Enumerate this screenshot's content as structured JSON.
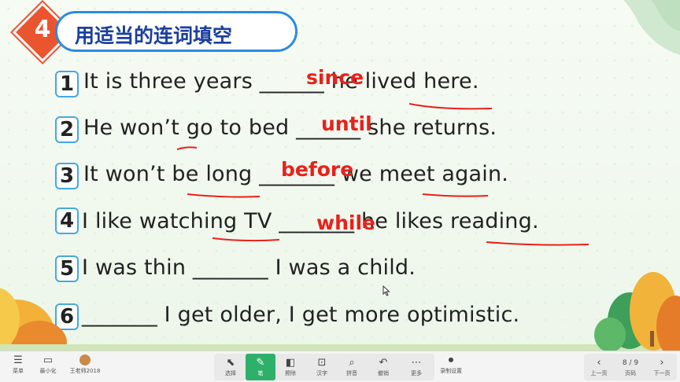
{
  "slide": {
    "number": "4",
    "title": "用适当的连词填空",
    "sentences": [
      {
        "num": "1",
        "text": "It is three years ______ he lived here.",
        "answer": "since"
      },
      {
        "num": "2",
        "text": "He won’t go to bed ______ she returns.",
        "answer": "until"
      },
      {
        "num": "3",
        "text": "It won’t be long _______ we meet again.",
        "answer": "before"
      },
      {
        "num": "4",
        "text": "I like watching TV _______ he likes reading.",
        "answer": "while"
      },
      {
        "num": "5",
        "text": "I was thin _______ I was a child.",
        "answer": ""
      },
      {
        "num": "6",
        "text": "_______ I get older, I get more optimistic.",
        "answer": ""
      }
    ]
  },
  "toolbar": {
    "left": [
      {
        "label": "菜单",
        "icon": "menu-icon"
      },
      {
        "label": "最小化",
        "icon": "minimize-icon"
      },
      {
        "label": "王老师2018",
        "icon": "avatar"
      }
    ],
    "tools": [
      {
        "label": "选择",
        "icon": "cursor-icon"
      },
      {
        "label": "笔",
        "icon": "pen-icon"
      },
      {
        "label": "擦除",
        "icon": "eraser-icon"
      },
      {
        "label": "汉字",
        "icon": "hanzi-icon"
      },
      {
        "label": "拼音",
        "icon": "pinyin-icon"
      },
      {
        "label": "撤销",
        "icon": "undo-icon"
      },
      {
        "label": "更多",
        "icon": "more-icon"
      }
    ],
    "record": {
      "label": "录制设置",
      "icon": "record-icon"
    },
    "nav": {
      "prev": "上一页",
      "page": "8 / 9",
      "page_label": "页码",
      "next": "下一页"
    }
  },
  "colors": {
    "accent": "#2fb06a",
    "answer": "#e8211a",
    "title": "#1a3f9e",
    "badge": "#ea5530"
  }
}
